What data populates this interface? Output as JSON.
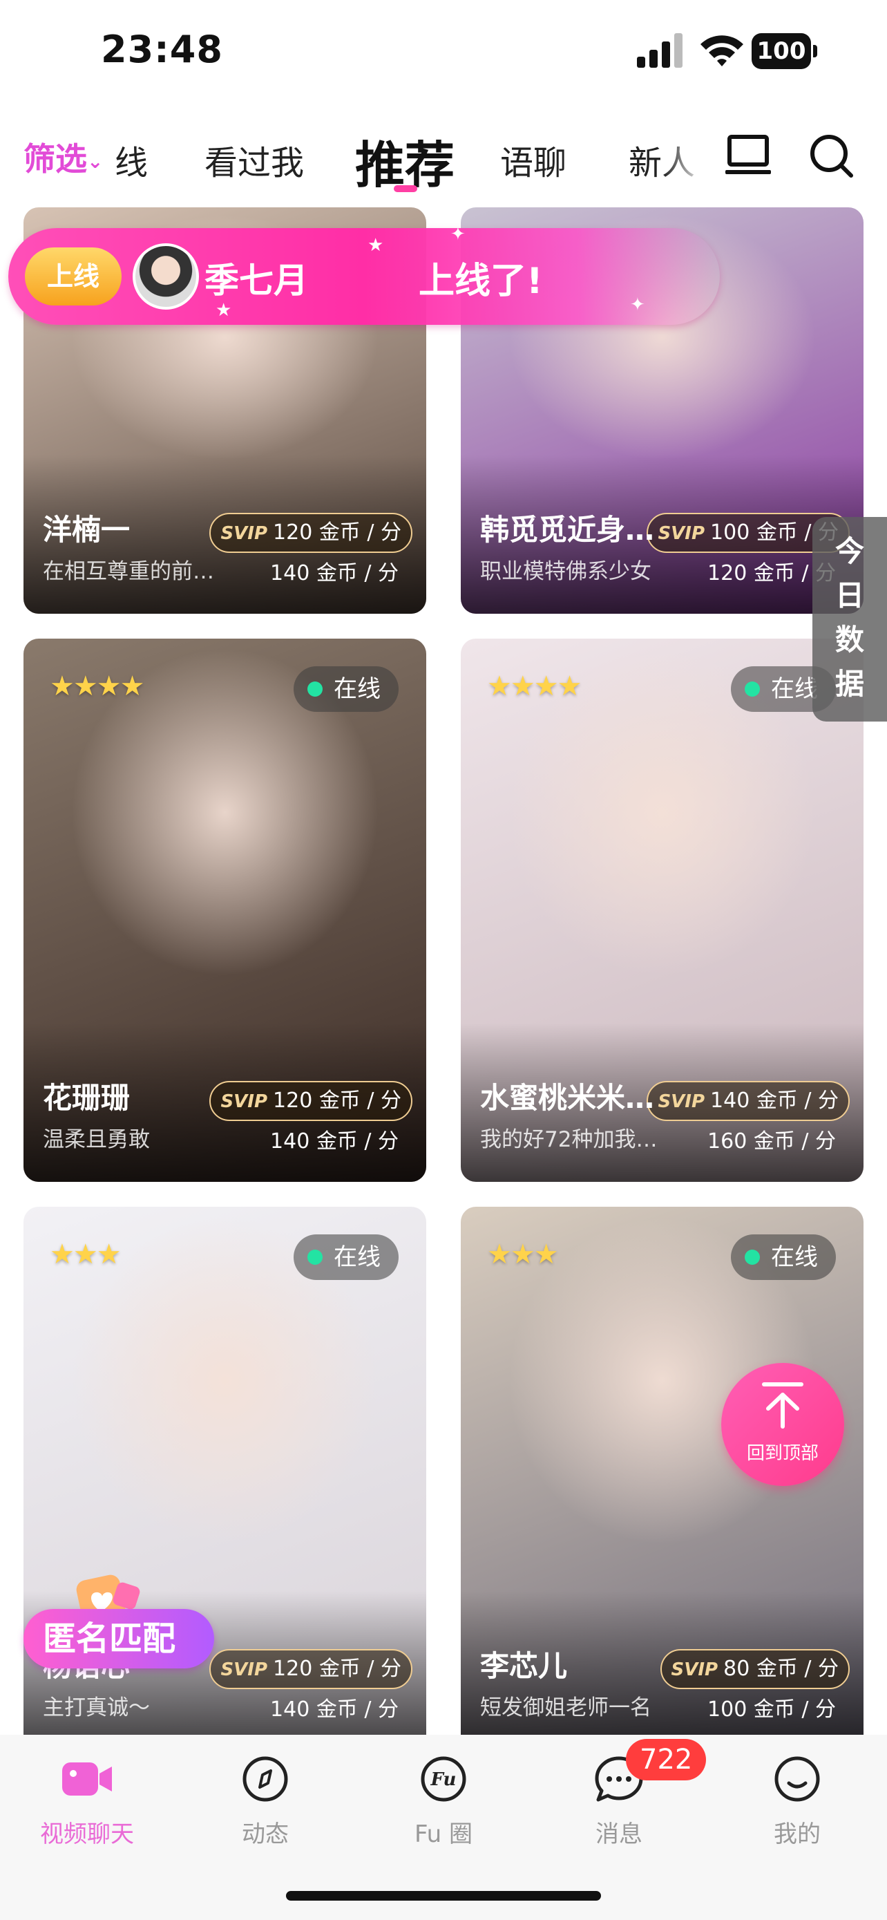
{
  "status_bar": {
    "time": "23:48",
    "battery": "100"
  },
  "top_nav": {
    "filter_label": "筛选",
    "tabs": [
      "线",
      "看过我",
      "推荐",
      "语聊",
      "新人"
    ],
    "active_tab": "推荐"
  },
  "cards": [
    {
      "name": "洋楠一",
      "desc": "在相互尊重的前…",
      "svip_tag": "SVIP",
      "svip_price": "120 金币 / 分",
      "price": "140 金币 / 分",
      "colors": [
        "#d7c3b4",
        "#5b4a40"
      ]
    },
    {
      "name": "韩觅觅近身高…",
      "desc": "职业模特佛系少女",
      "svip_tag": "SVIP",
      "svip_price": "100 金币 / 分",
      "price": "120 金币 / 分",
      "colors": [
        "#c9c3d2",
        "#8a3aa0"
      ]
    },
    {
      "name": "花珊珊",
      "desc": "温柔且勇敢",
      "stars": "★★★★",
      "online": "在线",
      "svip_tag": "SVIP",
      "svip_price": "120 金币 / 分",
      "price": "140 金币 / 分",
      "colors": [
        "#8a7a6c",
        "#3a2a24"
      ]
    },
    {
      "name": "水蜜桃米米…",
      "desc": "我的好72种加我…",
      "stars": "★★★★",
      "online": "在线",
      "svip_tag": "SVIP",
      "svip_price": "140 金币 / 分",
      "price": "160 金币 / 分",
      "colors": [
        "#f0e6ea",
        "#c9b6bc"
      ]
    },
    {
      "name": "杨语心",
      "desc": "主打真诚～",
      "stars": "★★★",
      "online": "在线",
      "svip_tag": "SVIP",
      "svip_price": "120 金币 / 分",
      "price": "140 金币 / 分",
      "colors": [
        "#f2f1f5",
        "#d8d2d8"
      ]
    },
    {
      "name": "李芯儿",
      "desc": "短发御姐老师一名",
      "stars": "★★★",
      "online": "在线",
      "svip_tag": "SVIP",
      "svip_price": "80 金币 / 分",
      "price": "100 金币 / 分",
      "colors": [
        "#d9cdbf",
        "#6e6a78"
      ]
    }
  ],
  "online_banner": {
    "badge": "上线",
    "name": "季七月",
    "message": "上线了!"
  },
  "side_panel": {
    "label": "今日数据"
  },
  "anonymous_match": {
    "label": "匿名匹配"
  },
  "back_to_top": {
    "label": "回到顶部"
  },
  "tab_bar": {
    "items": [
      {
        "label": "视频聊天",
        "icon": "video-camera-icon"
      },
      {
        "label": "动态",
        "icon": "compass-icon"
      },
      {
        "label": "Fu 圈",
        "icon": "fu-circle-icon"
      },
      {
        "label": "消息",
        "icon": "message-bubble-icon"
      },
      {
        "label": "我的",
        "icon": "smiley-icon"
      }
    ],
    "active_index": 0,
    "message_badge": "722"
  },
  "colors": {
    "accent": "#e96bd6",
    "banner": "#ff2ea6",
    "online_dot": "#23e3a3",
    "badge": "#ff3d3d"
  }
}
